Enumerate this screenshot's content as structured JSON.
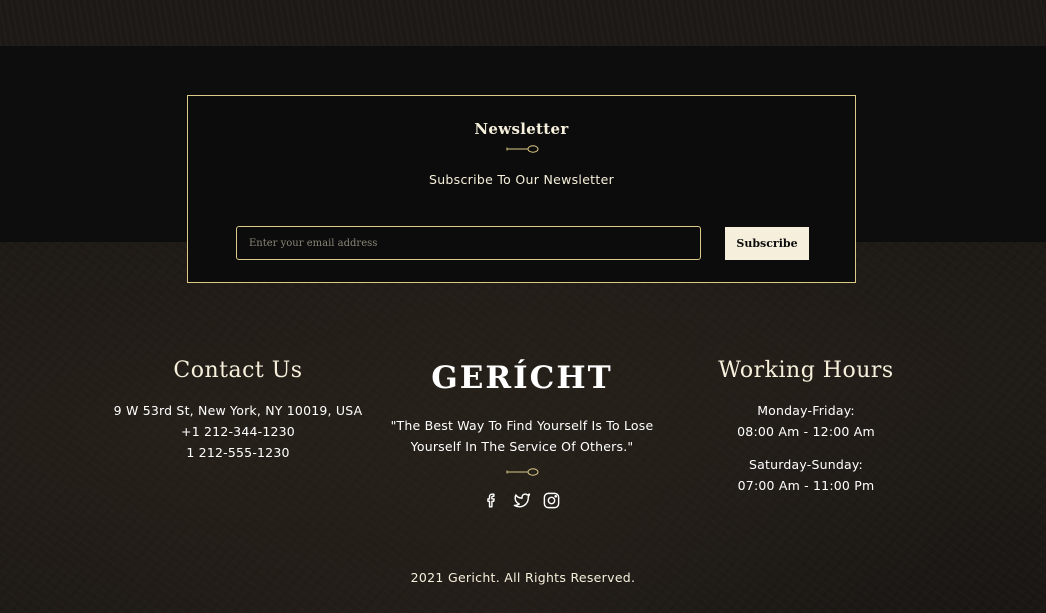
{
  "newsletter": {
    "title": "Newsletter",
    "subtitle": "Subscribe To Our Newsletter",
    "email_placeholder": "Enter your email address",
    "email_value": "",
    "subscribe_label": "Subscribe"
  },
  "contact": {
    "title": "Contact Us",
    "address": "9 W 53rd St, New York, NY 10019, USA",
    "phone1": "+1 212-344-1230",
    "phone2": "1 212-555-1230"
  },
  "brand": {
    "logo": "GERÍCHT",
    "quote": "\"The Best Way To Find Yourself Is To Lose Yourself In The Service Of Others.\""
  },
  "socials": [
    {
      "icon": "facebook-icon"
    },
    {
      "icon": "twitter-icon"
    },
    {
      "icon": "instagram-icon"
    }
  ],
  "hours": {
    "title": "Working Hours",
    "weekday_label": "Monday-Friday:",
    "weekday_time": "08:00 Am - 12:00 Am",
    "weekend_label": "Saturday-Sunday:",
    "weekend_time": "07:00 Am - 11:00 Pm"
  },
  "footer": {
    "copyright": "2021 Gericht. All Rights Reserved."
  },
  "colors": {
    "accent": "#dcca87",
    "cream": "#f5efdb",
    "background": "#0c0c0c"
  }
}
